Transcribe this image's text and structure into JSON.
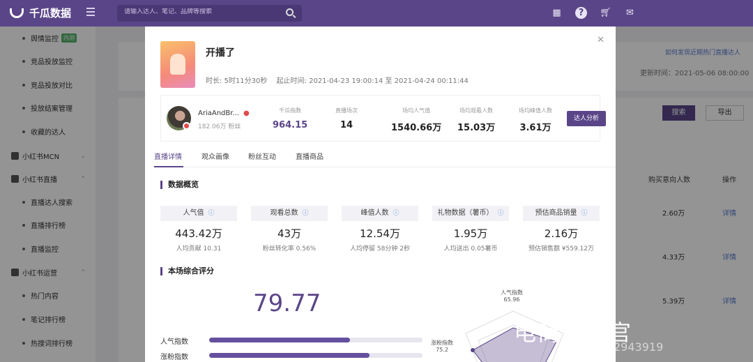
{
  "app": {
    "name": "千瓜数据",
    "search_placeholder": "请输入达人、笔记、品牌等搜索"
  },
  "sidebar": {
    "items": [
      {
        "label": "舆情监控",
        "badge": "内测"
      },
      {
        "label": "竞品投放监控"
      },
      {
        "label": "竞品投放对比"
      },
      {
        "label": "投放结案管理"
      },
      {
        "label": "收藏的达人"
      },
      {
        "label": "小红书MCN"
      },
      {
        "label": "小红书直播"
      },
      {
        "label": "直播达人搜索"
      },
      {
        "label": "直播排行榜"
      },
      {
        "label": "直播监控"
      },
      {
        "label": "小红书运营"
      },
      {
        "label": "热门内容"
      },
      {
        "label": "笔记排行榜"
      },
      {
        "label": "热搜词排行榜"
      }
    ]
  },
  "background": {
    "help_link": "如何发现近期热门直播达人",
    "update_time": "更新时间：2021-05-06 08:00:00",
    "search_btn": "搜索",
    "export_btn": "导出",
    "col_buy": "购买意向人数",
    "col_op": "操作",
    "rows": [
      {
        "buy": "2.60万",
        "op": "详情"
      },
      {
        "buy": "4.33万",
        "op": "详情"
      },
      {
        "buy": "5.39万",
        "op": "详情"
      }
    ]
  },
  "modal": {
    "title": "开播了",
    "duration": "时长: 5时11分30秒",
    "time_range": "起止时间: 2021-04-23 19:00:14 至 2021-04-24 00:11:44",
    "account": {
      "name": "AriaAndBr...",
      "fans": "182.06万 粉丝"
    },
    "stats": [
      {
        "label": "千瓜指数",
        "value": "964.15"
      },
      {
        "label": "直播场次",
        "value": "14"
      },
      {
        "label": "场均人气值",
        "value": "1540.66万"
      },
      {
        "label": "场均观看人数",
        "value": "15.03万"
      },
      {
        "label": "场均峰值人数",
        "value": "3.61万"
      }
    ],
    "analysis_btn": "达人分析",
    "tabs": [
      "直播详情",
      "观众画像",
      "粉丝互动",
      "直播商品"
    ],
    "overview_title": "数据概览",
    "kpis": [
      {
        "label": "人气值",
        "value": "443.42万",
        "sub": "人均贡献 10.31"
      },
      {
        "label": "观看总数",
        "value": "43万",
        "sub": "粉丝转化率 0.56%"
      },
      {
        "label": "峰值人数",
        "value": "12.54万",
        "sub": "人均停留 58分钟 2秒"
      },
      {
        "label": "礼物数据（薯币）",
        "value": "1.95万",
        "sub": "人均送出 0.05薯币"
      },
      {
        "label": "预估商品销量",
        "value": "2.16万",
        "sub": "预估销售额 ¥559.12万"
      }
    ],
    "score_title": "本场综合评分",
    "score": "79.77",
    "bars": [
      {
        "label": "人气指数",
        "fill": 0.66
      },
      {
        "label": "涨粉指数",
        "fill": 0.75
      }
    ],
    "radar": {
      "top": {
        "label": "人气指数",
        "value": "65.96"
      },
      "left": {
        "label": "涨粉指数",
        "value": "75.2"
      }
    }
  },
  "watermark": {
    "main": "电商运营官",
    "sub": "2943919"
  }
}
